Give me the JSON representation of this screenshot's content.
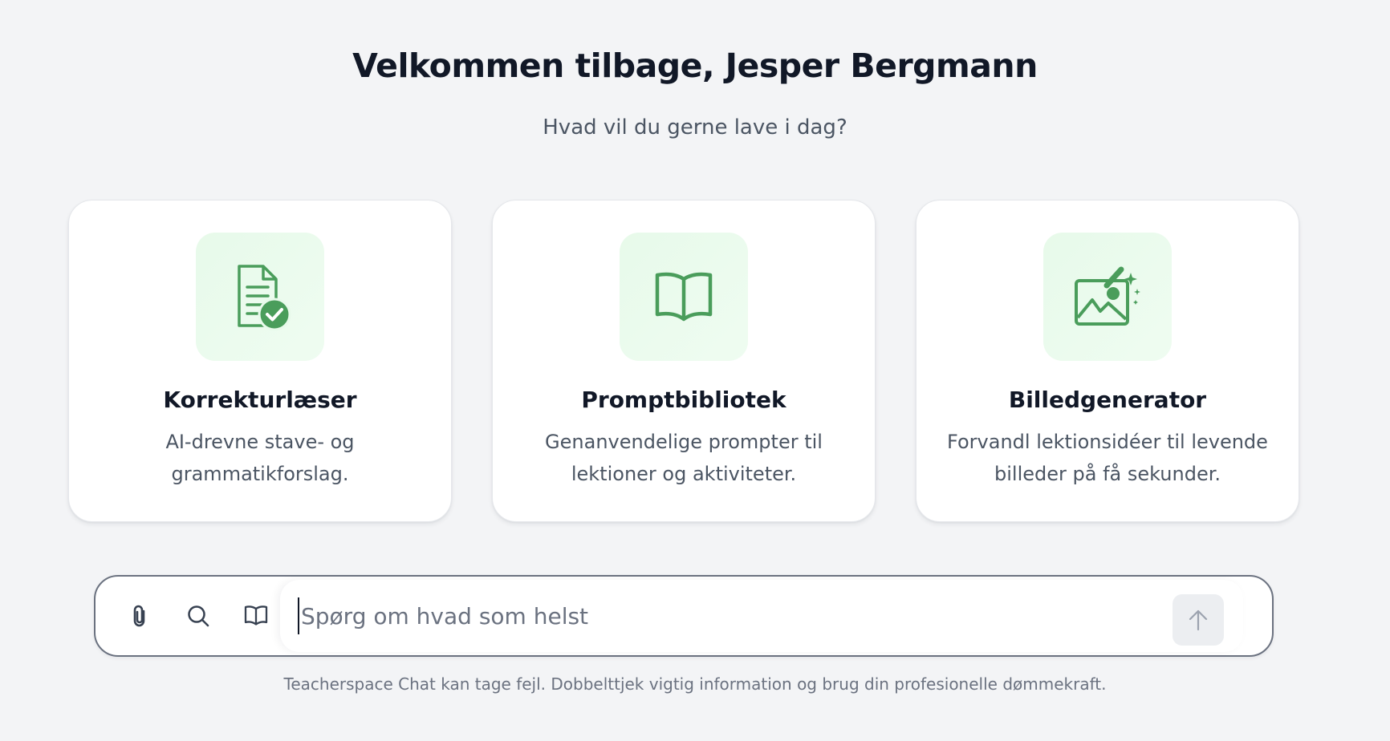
{
  "header": {
    "title": "Velkommen tilbage, Jesper Bergmann",
    "subtitle": "Hvad vil du gerne lave i dag?"
  },
  "cards": [
    {
      "icon": "document-check-icon",
      "title": "Korrekturlæser",
      "description": "AI-drevne stave- og grammatikforslag."
    },
    {
      "icon": "open-book-icon",
      "title": "Promptbibliotek",
      "description": "Genanvendelige prompter til lektioner og aktiviteter."
    },
    {
      "icon": "image-sparkle-icon",
      "title": "Billedgenerator",
      "description": "Forvandl lektionsidéer til levende billeder på få sekunder."
    }
  ],
  "composer": {
    "placeholder": "Spørg om hvad som helst",
    "value": "",
    "tools": [
      "paperclip-icon",
      "search-icon",
      "book-icon"
    ],
    "send_icon": "arrow-up-icon"
  },
  "footer": {
    "disclaimer": "Teacherspace Chat kan tage fejl. Dobbelttjek vigtig information og brug din profesionelle dømmekraft."
  },
  "colors": {
    "background": "#f3f4f6",
    "accent_green": "#4a9d5b",
    "icon_tile": "#e8faeb",
    "text_primary": "#111827",
    "text_secondary": "#4b5563"
  }
}
